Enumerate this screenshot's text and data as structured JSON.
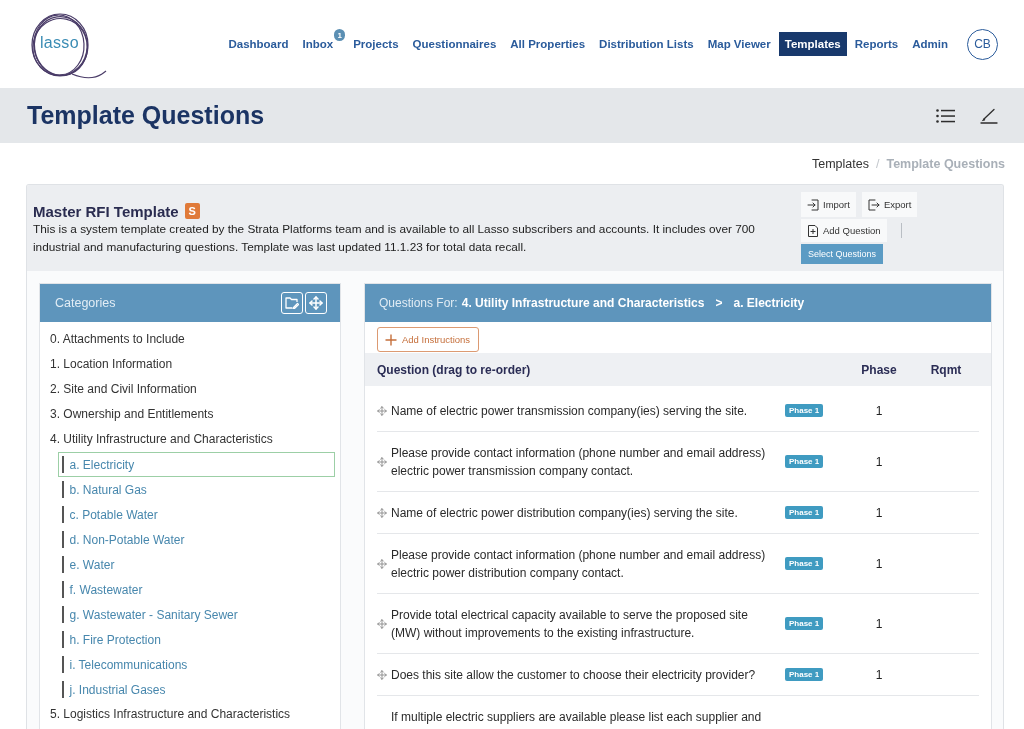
{
  "header": {
    "logo": "lasso",
    "nav": [
      {
        "label": "Dashboard",
        "selected": false
      },
      {
        "label": "Inbox",
        "selected": false,
        "badge": "1"
      },
      {
        "label": "Projects",
        "selected": false
      },
      {
        "label": "Questionnaires",
        "selected": false
      },
      {
        "label": "All Properties",
        "selected": false
      },
      {
        "label": "Distribution Lists",
        "selected": false
      },
      {
        "label": "Map Viewer",
        "selected": false
      },
      {
        "label": "Templates",
        "selected": true
      },
      {
        "label": "Reports",
        "selected": false
      },
      {
        "label": "Admin",
        "selected": false
      }
    ],
    "avatar": "CB"
  },
  "page_title": "Template Questions",
  "breadcrumb": {
    "separator": "/",
    "items": [
      {
        "label": "Templates",
        "current": false
      },
      {
        "label": "Template Questions",
        "current": true
      }
    ]
  },
  "template": {
    "title": "Master RFI Template",
    "badge": "S",
    "description": "This is a system template created by the Strata Platforms team and is available to all Lasso subscribers and accounts. It includes over 700 industrial and manufacturing questions. Template was last updated 11.1.23 for total data recall.",
    "actions": [
      {
        "kind": "import",
        "label": "Import"
      },
      {
        "kind": "export",
        "label": "Export"
      },
      {
        "kind": "add",
        "label": "Add Question"
      },
      {
        "kind": "primary",
        "label": "Select Questions"
      }
    ]
  },
  "categories": {
    "title": "Categories",
    "items": [
      {
        "label": "0. Attachments to Include",
        "selected": false
      },
      {
        "label": "1. Location Information",
        "selected": false
      },
      {
        "label": "2. Site and Civil Information",
        "selected": false
      },
      {
        "label": "3. Ownership and Entitlements",
        "selected": false
      },
      {
        "label": "4. Utility Infrastructure and Characteristics",
        "selected": false,
        "children": [
          {
            "label": "a. Electricity",
            "selected": true
          },
          {
            "label": "b. Natural Gas",
            "selected": false
          },
          {
            "label": "c. Potable Water",
            "selected": false
          },
          {
            "label": "d. Non-Potable Water",
            "selected": false
          },
          {
            "label": "e. Water",
            "selected": false
          },
          {
            "label": "f. Wastewater",
            "selected": false
          },
          {
            "label": "g. Wastewater - Sanitary Sewer",
            "selected": false
          },
          {
            "label": "h. Fire Protection",
            "selected": false
          },
          {
            "label": "i. Telecommunications",
            "selected": false
          },
          {
            "label": "j. Industrial Gases",
            "selected": false
          }
        ]
      },
      {
        "label": "5. Logistics Infrastructure and Characteristics",
        "selected": false
      }
    ]
  },
  "questions": {
    "label": "Questions For:",
    "category": "4. Utility Infrastructure and Characteristics",
    "separator": ">",
    "subcategory": "a. Electricity",
    "add_instructions": "Add Instructions",
    "columns": [
      "Question (drag to re-order)",
      "Phase",
      "Rqmt"
    ],
    "rows": [
      {
        "question": "Name of electric power transmission company(ies) serving the site.",
        "badge": "Phase 1",
        "phase": "1"
      },
      {
        "question": "Please provide contact information (phone number and email address) electric power transmission company contact.",
        "badge": "Phase 1",
        "phase": "1"
      },
      {
        "question": "Name of electric power distribution company(ies) serving the site.",
        "badge": "Phase 1",
        "phase": "1"
      },
      {
        "question": "Please provide contact information (phone number and email address) electric power distribution company contact.",
        "badge": "Phase 1",
        "phase": "1"
      },
      {
        "question": "Provide total electrical capacity available to serve the proposed site (MW) without improvements to the existing infrastructure.",
        "badge": "Phase 1",
        "phase": "1"
      },
      {
        "question": "Does this site allow the customer to choose their electricity provider?",
        "badge": "Phase 1",
        "phase": "1"
      },
      {
        "question": "If multiple electric suppliers are available please list each supplier and"
      }
    ]
  }
}
